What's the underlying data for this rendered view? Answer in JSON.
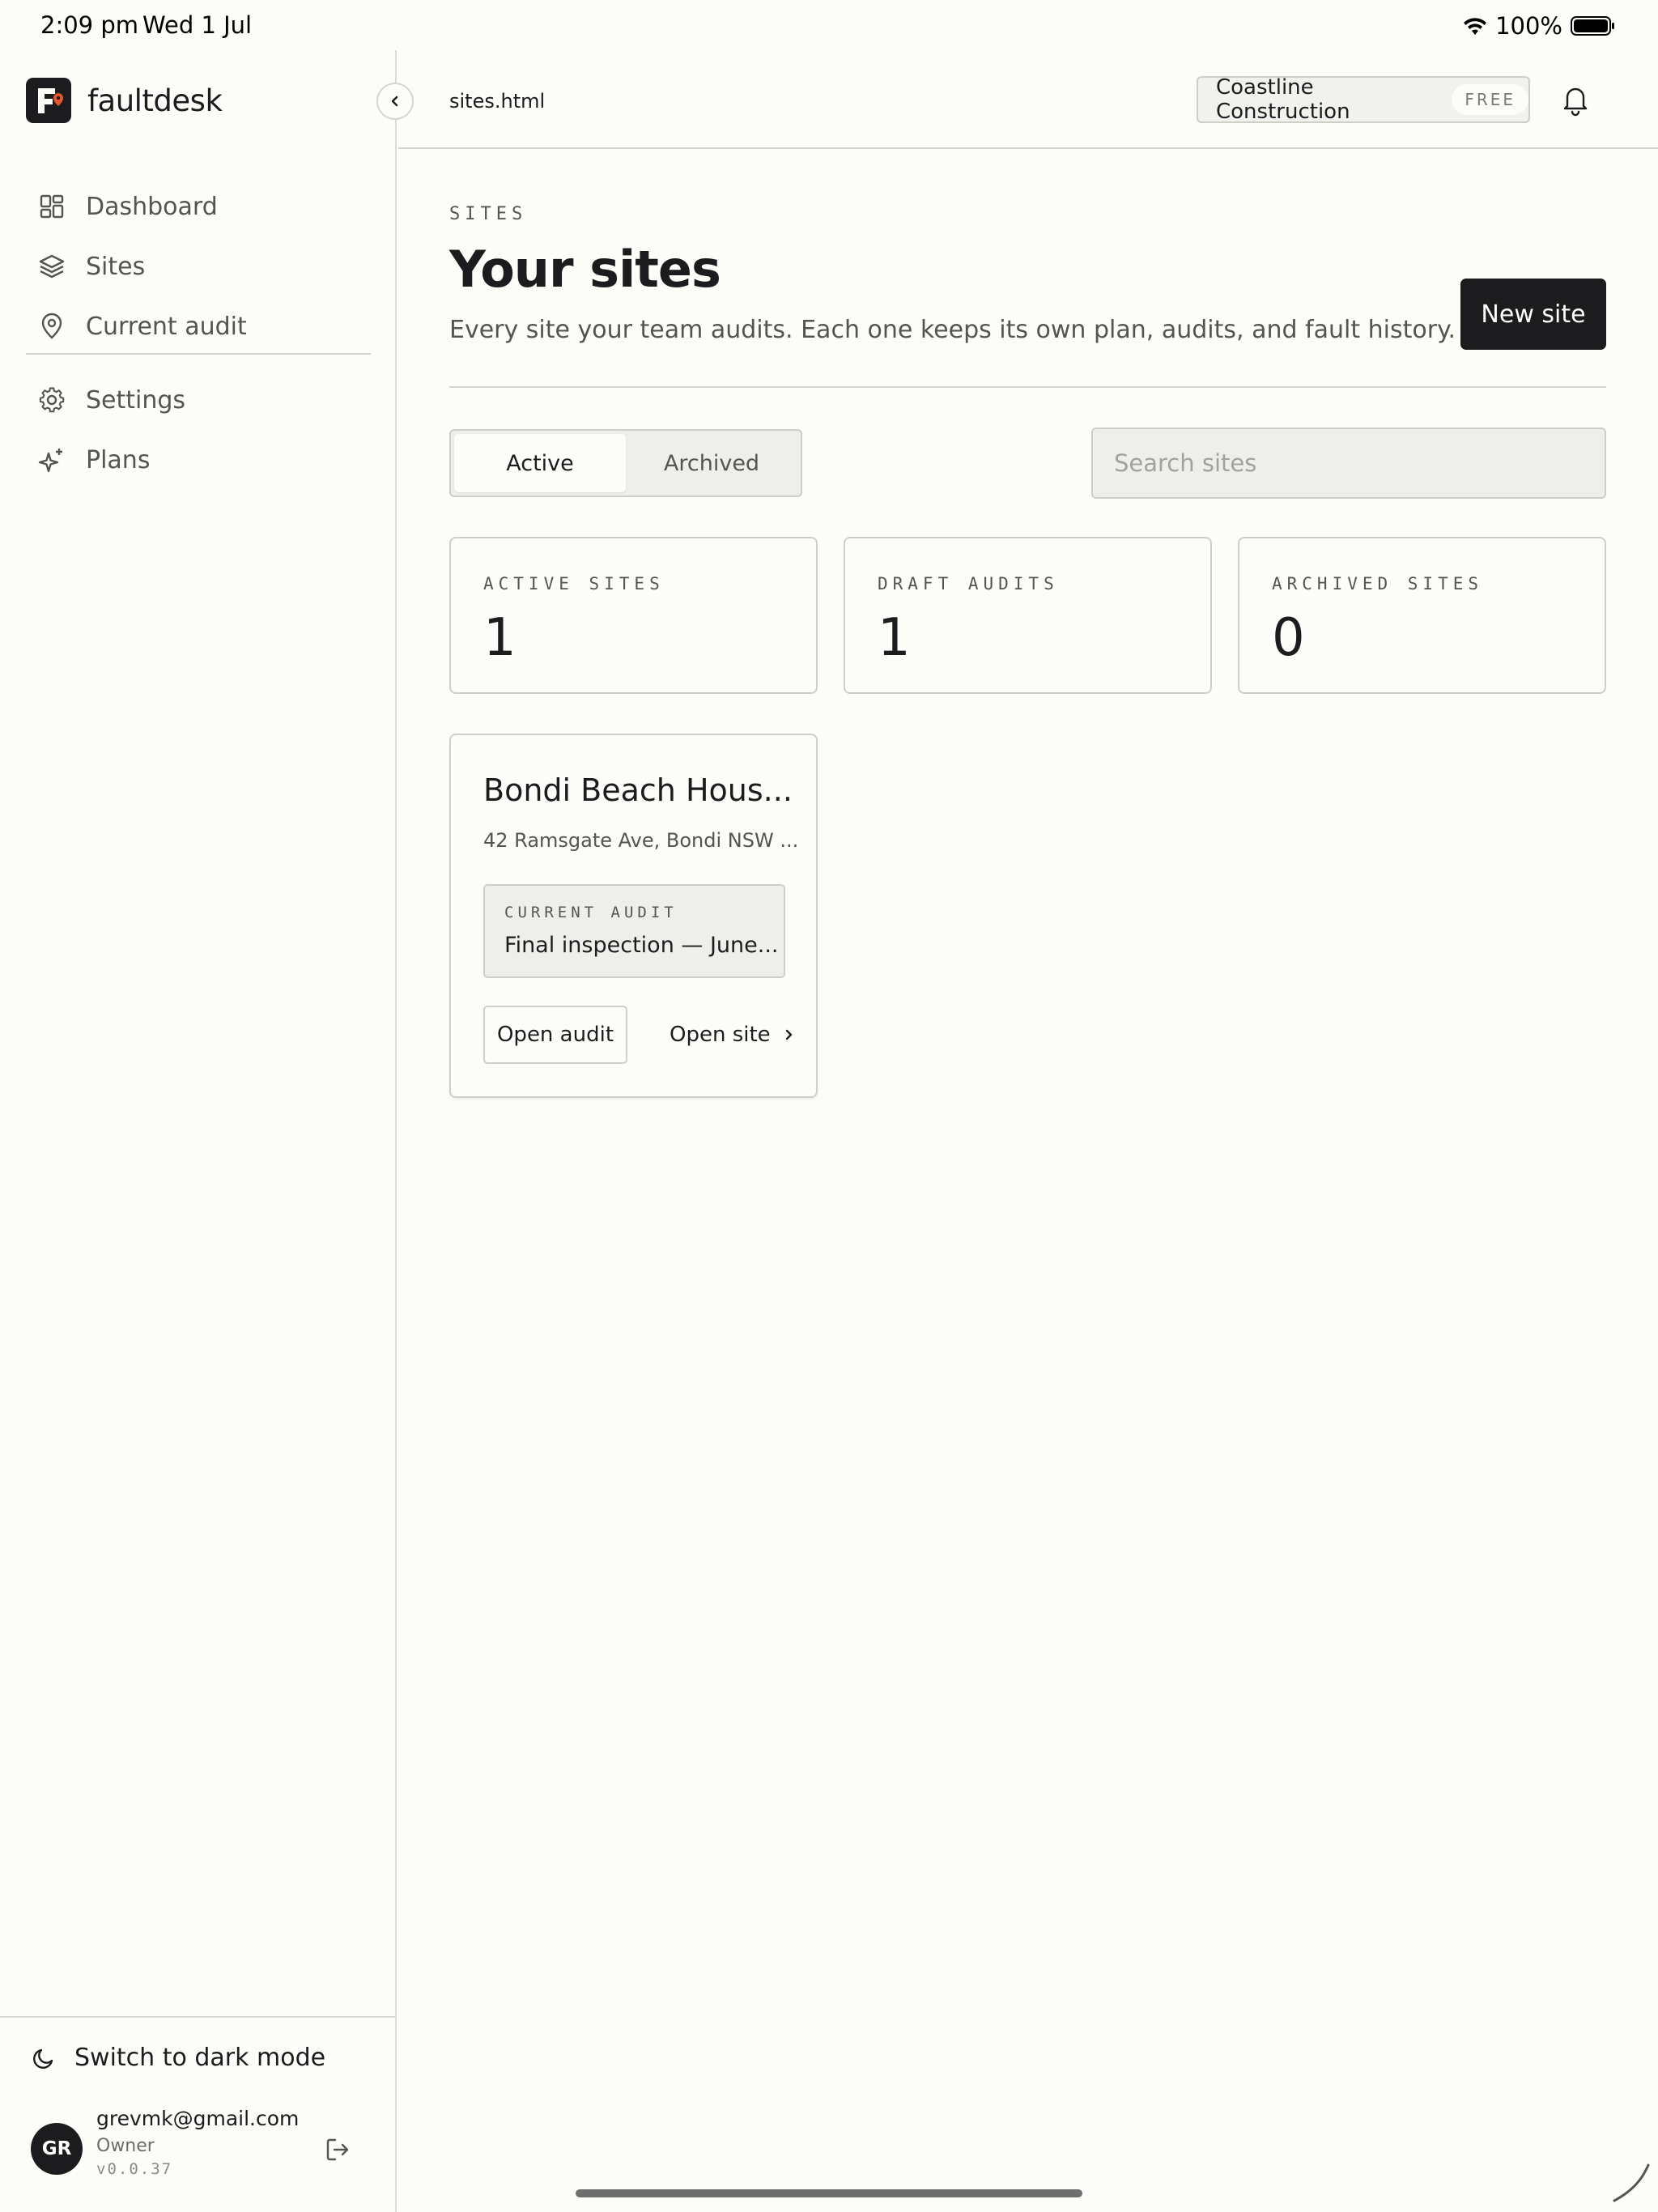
{
  "status_bar": {
    "time": "2:09 pm",
    "date": "Wed 1 Jul",
    "battery": "100%"
  },
  "sidebar": {
    "brand": "faultdesk",
    "nav_primary": [
      {
        "label": "Dashboard",
        "icon": "dashboard-icon"
      },
      {
        "label": "Sites",
        "icon": "layers-icon"
      },
      {
        "label": "Current audit",
        "icon": "map-pin-icon"
      }
    ],
    "nav_secondary": [
      {
        "label": "Settings",
        "icon": "gear-icon"
      },
      {
        "label": "Plans",
        "icon": "sparkles-icon"
      }
    ],
    "dark_mode_label": "Switch to dark mode",
    "user": {
      "initials": "GR",
      "email": "grevmk@gmail.com",
      "role": "Owner",
      "version": "v0.0.37"
    }
  },
  "topbar": {
    "path": "sites.html",
    "org_name": "Coastline Construction",
    "org_plan": "FREE"
  },
  "header": {
    "eyebrow": "SITES",
    "title": "Your sites",
    "subtitle": "Every site your team audits. Each one keeps its own plan, audits, and fault history.",
    "new_button": "New site"
  },
  "filters": {
    "tabs": [
      {
        "label": "Active",
        "selected": true
      },
      {
        "label": "Archived",
        "selected": false
      }
    ],
    "search_placeholder": "Search sites"
  },
  "stats": [
    {
      "label": "ACTIVE SITES",
      "value": "1"
    },
    {
      "label": "DRAFT AUDITS",
      "value": "1"
    },
    {
      "label": "ARCHIVED SITES",
      "value": "0"
    }
  ],
  "sites": [
    {
      "name": "Bondi Beach Hous...",
      "address": "42 Ramsgate Ave, Bondi NSW ...",
      "current_audit_label": "CURRENT AUDIT",
      "current_audit_name": "Final inspection — June...",
      "open_audit": "Open audit",
      "open_site": "Open site"
    }
  ],
  "colors": {
    "accent": "#1c1c1e",
    "background": "#fcfcf9",
    "logo_accent": "#e8552f"
  }
}
